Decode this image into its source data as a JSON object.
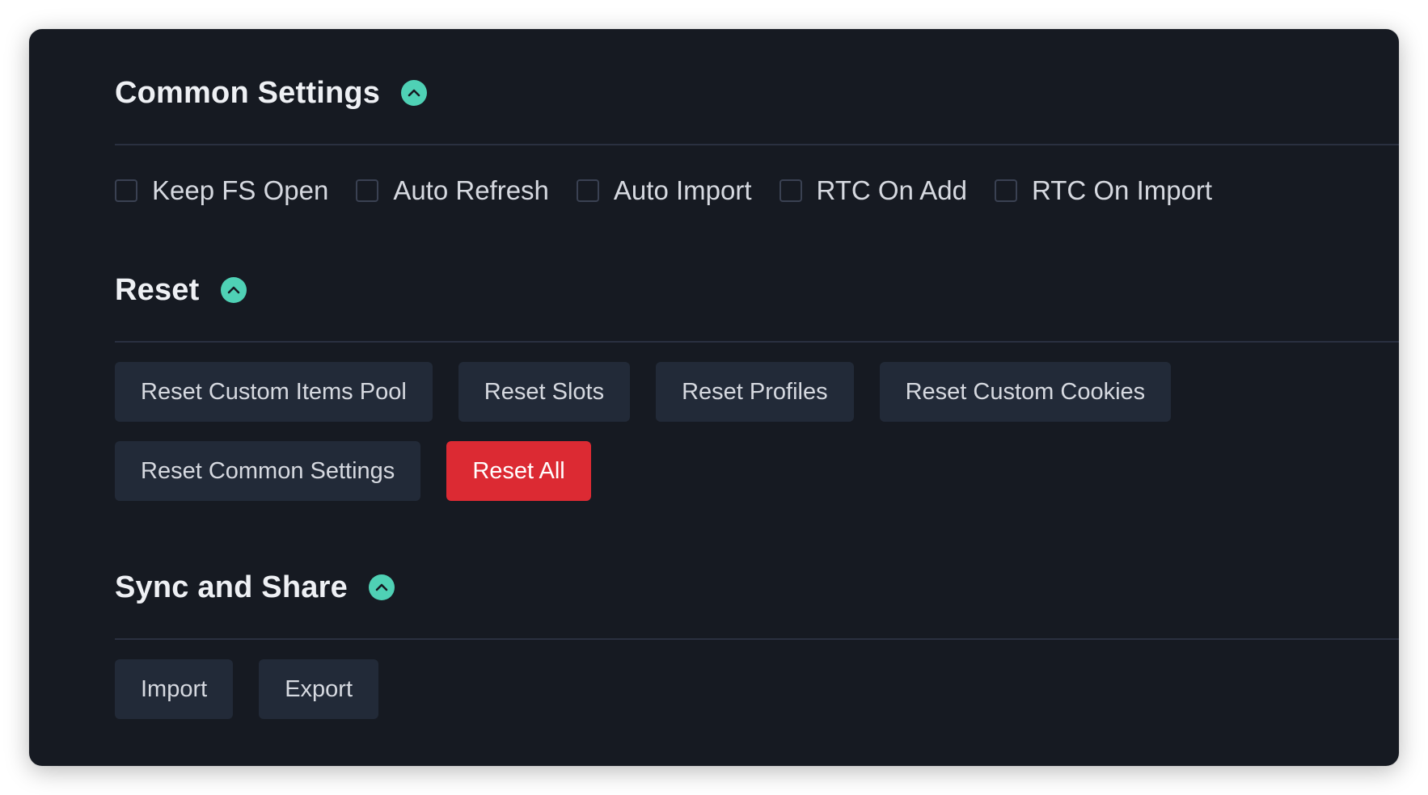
{
  "colors": {
    "background": "#161a22",
    "accent": "#4fd1b5",
    "button": "#222a38",
    "danger": "#dc2a33"
  },
  "sections": {
    "common_settings": {
      "title": "Common Settings",
      "toggle_icon": "chevron-up-icon",
      "checkboxes": [
        {
          "label": "Keep FS Open",
          "checked": false
        },
        {
          "label": "Auto Refresh",
          "checked": false
        },
        {
          "label": "Auto Import",
          "checked": false
        },
        {
          "label": "RTC On Add",
          "checked": false
        },
        {
          "label": "RTC On Import",
          "checked": false
        }
      ]
    },
    "reset": {
      "title": "Reset",
      "toggle_icon": "chevron-up-icon",
      "buttons": {
        "custom_items_pool": "Reset Custom Items Pool",
        "slots": "Reset Slots",
        "profiles": "Reset Profiles",
        "custom_cookies": "Reset Custom Cookies",
        "common_settings": "Reset Common Settings",
        "all": "Reset All"
      }
    },
    "sync_share": {
      "title": "Sync and Share",
      "toggle_icon": "chevron-up-icon",
      "buttons": {
        "import": "Import",
        "export": "Export"
      }
    }
  }
}
